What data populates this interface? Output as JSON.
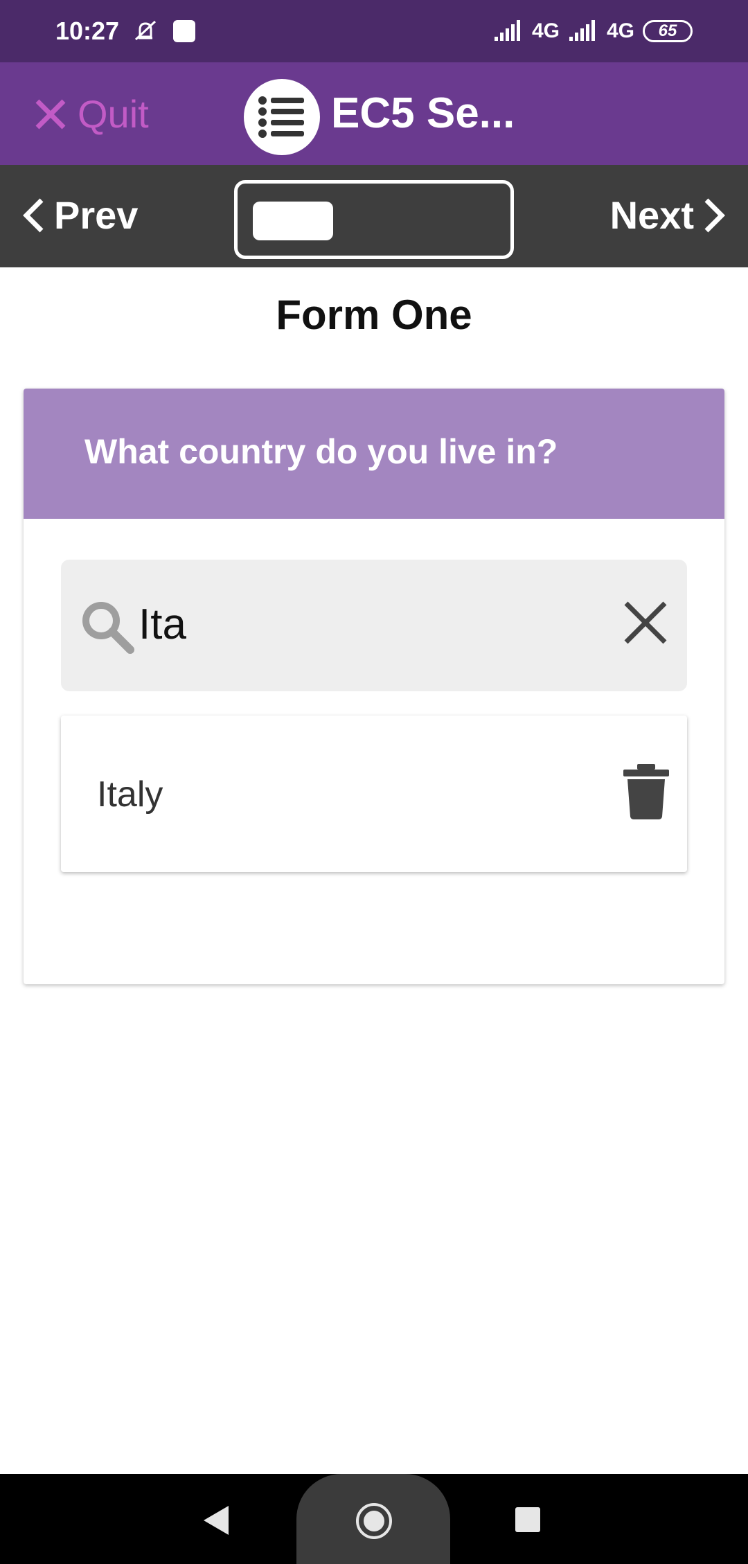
{
  "status_bar": {
    "time": "10:27",
    "network_1": "4G",
    "network_2": "4G",
    "battery": "65"
  },
  "app_bar": {
    "quit_label": "Quit",
    "title": "EC5 Se..."
  },
  "nav": {
    "prev_label": "Prev",
    "next_label": "Next",
    "progress": 0.33
  },
  "form": {
    "title": "Form One",
    "question": "What country do you live in?",
    "search": {
      "value": "Ita"
    },
    "results": [
      {
        "label": "Italy"
      }
    ]
  },
  "colors": {
    "status_bar": "#4b2a69",
    "app_bar": "#6a3a8f",
    "quit": "#c25bc6",
    "nav_bar": "#3e3e3e",
    "question_header": "#a386c0"
  },
  "icons": [
    "bell-off-icon",
    "notification-square-icon",
    "signal-icon",
    "battery-icon",
    "close-icon",
    "list-icon",
    "chevron-left-icon",
    "chevron-right-icon",
    "search-icon",
    "clear-icon",
    "trash-icon",
    "back-icon",
    "home-icon",
    "recents-icon"
  ]
}
